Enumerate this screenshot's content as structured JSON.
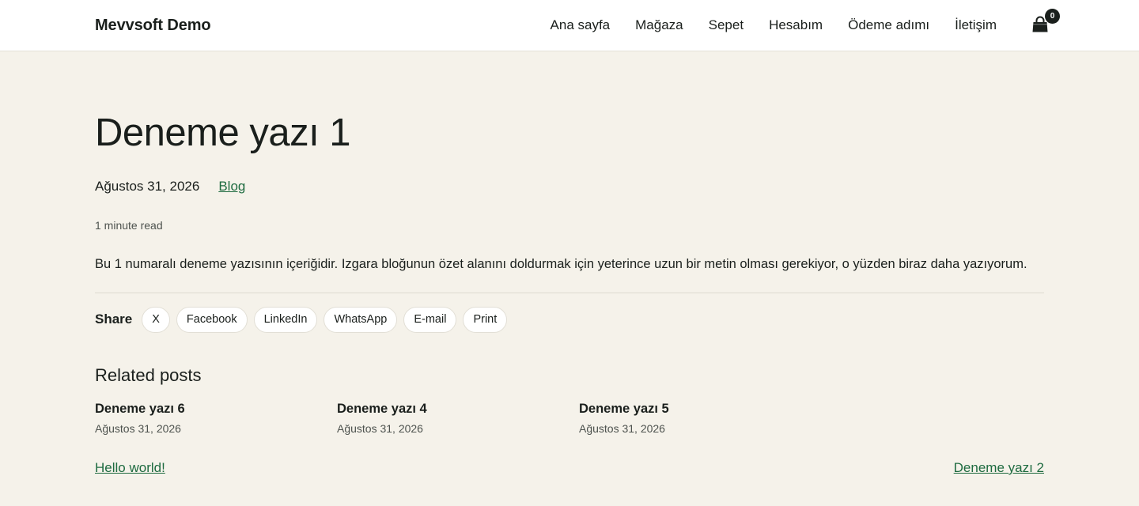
{
  "header": {
    "site_title": "Mevvsoft Demo",
    "nav": [
      "Ana sayfa",
      "Mağaza",
      "Sepet",
      "Hesabım",
      "Ödeme adımı",
      "İletişim"
    ],
    "cart_icon": "shopping-bag-icon",
    "cart_count": "0"
  },
  "post": {
    "title": "Deneme yazı 1",
    "date": "Ağustos 31, 2026",
    "category": "Blog",
    "read_time": "1 minute read",
    "excerpt": "Bu 1 numaralı deneme yazısının içeriğidir. Izgara bloğunun özet alanını doldurmak için yeterince uzun bir metin olması gerekiyor, o yüzden biraz daha yazıyorum."
  },
  "share": {
    "label": "Share",
    "buttons": [
      "X",
      "Facebook",
      "LinkedIn",
      "WhatsApp",
      "E-mail",
      "Print"
    ]
  },
  "related": {
    "title": "Related posts",
    "items": [
      {
        "title": "Deneme yazı 6",
        "date": "Ağustos 31, 2026"
      },
      {
        "title": "Deneme yazı 4",
        "date": "Ağustos 31, 2026"
      },
      {
        "title": "Deneme yazı 5",
        "date": "Ağustos 31, 2026"
      }
    ]
  },
  "post_nav": {
    "previous": "Hello world!",
    "next": "Deneme yazı 2"
  },
  "colors": {
    "background": "#f5f2ea",
    "header_bg": "#ffffff",
    "text": "#1a1f1c",
    "link": "#1e6b40"
  }
}
